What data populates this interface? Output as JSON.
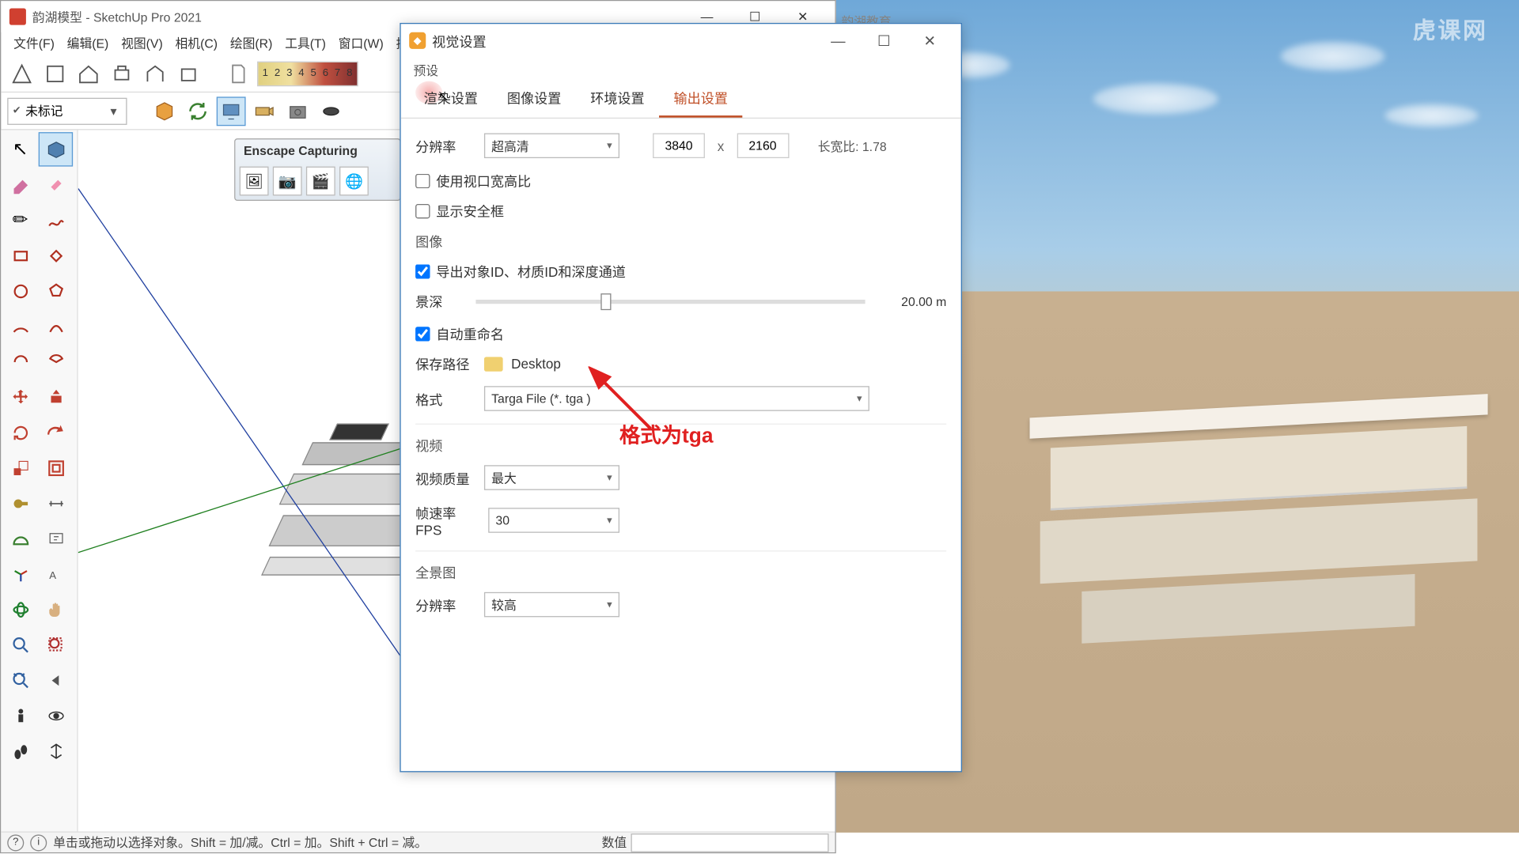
{
  "su": {
    "title": "韵湖模型 - SketchUp Pro 2021",
    "menu": [
      "文件(F)",
      "编辑(E)",
      "视图(V)",
      "相机(C)",
      "绘图(R)",
      "工具(T)",
      "窗口(W)",
      "扩展"
    ],
    "tag": "未标记",
    "days": [
      "1",
      "2",
      "3",
      "4",
      "5",
      "6",
      "7",
      "8"
    ],
    "capture_title": "Enscape Capturing",
    "status": "单击或拖动以选择对象。Shift = 加/减。Ctrl = 加。Shift + Ctrl = 减。",
    "status_value_label": "数值"
  },
  "vs": {
    "title": "视觉设置",
    "preset": "预设",
    "tabs": [
      "渲染设置",
      "图像设置",
      "环境设置",
      "输出设置"
    ],
    "active_tab": 3,
    "res_label": "分辨率",
    "res_preset": "超高清",
    "width": "3840",
    "height": "2160",
    "ratio_label": "长宽比:",
    "ratio": "1.78",
    "use_viewport": "使用视口宽高比",
    "show_safe": "显示安全框",
    "img_section": "图像",
    "export_ids": "导出对象ID、材质ID和深度通道",
    "dof_label": "景深",
    "dof_value": "20.00 m",
    "auto_rename": "自动重命名",
    "save_path_label": "保存路径",
    "save_path": "Desktop",
    "format_label": "格式",
    "format_value": "Targa File  (*. tga )",
    "video_section": "视频",
    "video_quality_label": "视频质量",
    "video_quality": "最大",
    "fps_label": "帧速率FPS",
    "fps": "30",
    "pano_section": "全景图",
    "pano_res_label": "分辨率",
    "pano_res": "较高"
  },
  "annotation": "格式为tga",
  "edu_text": "韵湖教育",
  "watermark": "虎课网"
}
